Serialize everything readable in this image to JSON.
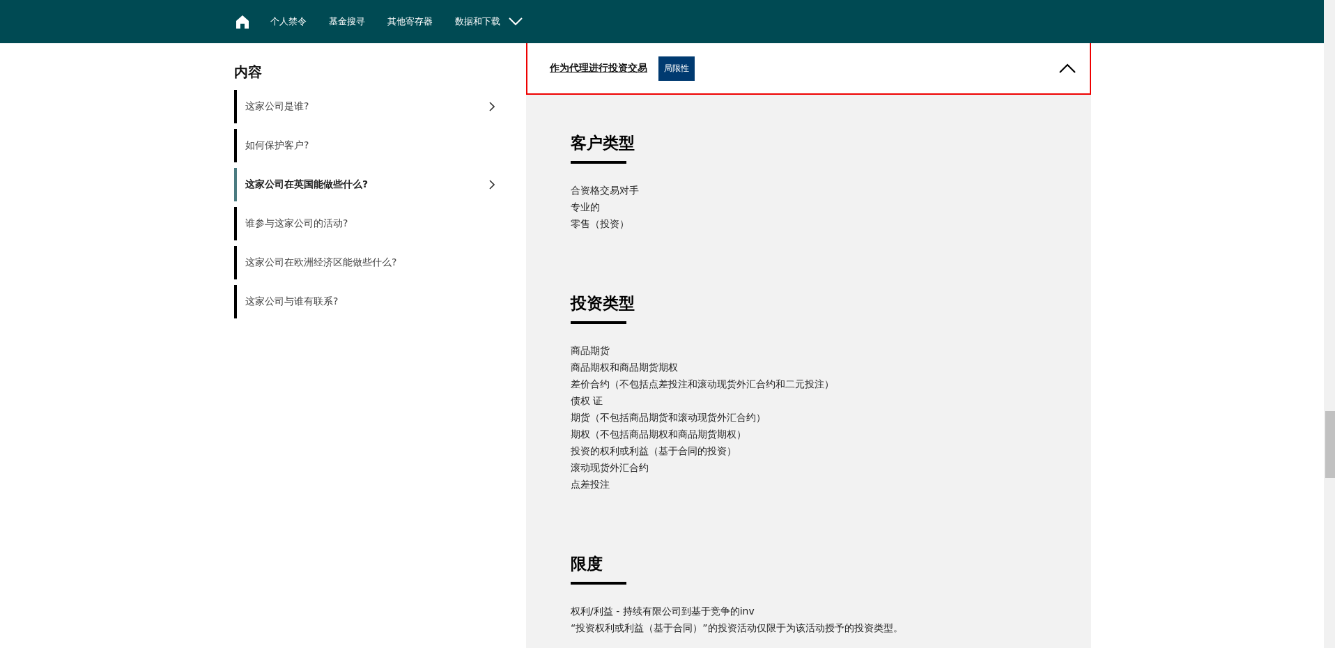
{
  "nav": {
    "items": [
      "个人禁令",
      "基金搜寻",
      "其他寄存器",
      "数据和下载"
    ]
  },
  "sidebar": {
    "title": "内容",
    "items": [
      {
        "label": "这家公司是谁?",
        "selected": false,
        "has_arrow": true
      },
      {
        "label": "如何保护客户?",
        "selected": false,
        "has_arrow": false
      },
      {
        "label": "这家公司在英国能做些什么?",
        "selected": true,
        "has_arrow": true
      },
      {
        "label": "谁参与这家公司的活动?",
        "selected": false,
        "has_arrow": false
      },
      {
        "label": "这家公司在欧洲经济区能做些什么?",
        "selected": false,
        "has_arrow": false
      },
      {
        "label": "这家公司与谁有联系?",
        "selected": false,
        "has_arrow": false
      }
    ]
  },
  "panel": {
    "title": "作为代理进行投资交易",
    "badge": "局限性",
    "expanded": true,
    "sections": [
      {
        "heading": "客户类型",
        "lines": [
          "合资格交易对手",
          "专业的",
          "零售（投资）"
        ]
      },
      {
        "heading": "投资类型",
        "lines": [
          "商品期货",
          "商品期权和商品期货期权",
          "差价合约（不包括点差投注和滚动现货外汇合约和二元投注）",
          "债权 证",
          "期货（不包括商品期货和滚动现货外汇合约）",
          "期权（不包括商品期权和商品期货期权）",
          "投资的权利或利益（基于合同的投资）",
          "滚动现货外汇合约",
          "点差投注"
        ]
      },
      {
        "heading": "限度",
        "lines": [
          "权利/利益 - 持续有限公司到基于竞争的inv",
          "“投资权利或利益（基于合同）”的投资活动仅限于为该活动授予的投资类型。"
        ]
      }
    ]
  }
}
